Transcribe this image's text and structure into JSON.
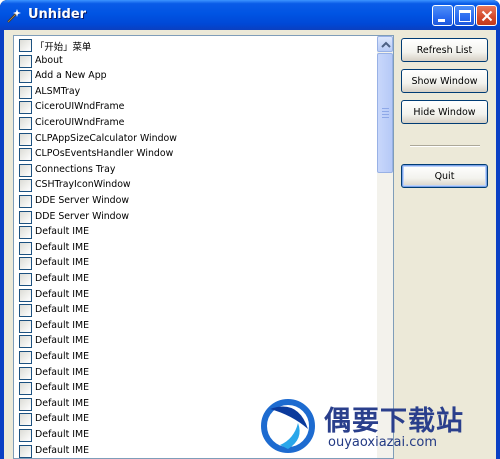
{
  "window": {
    "title": "Unhider",
    "controls": [
      "minimize-icon",
      "maximize-icon",
      "close-icon"
    ]
  },
  "list": {
    "items": [
      "「开始」菜单",
      "About",
      "Add a New App",
      "ALSMTray",
      "CiceroUIWndFrame",
      "CiceroUIWndFrame",
      "CLPAppSizeCalculator Window",
      "CLPOsEventsHandler Window",
      "Connections Tray",
      "CSHTrayIconWindow",
      "DDE Server Window",
      "DDE Server Window",
      "Default IME",
      "Default IME",
      "Default IME",
      "Default IME",
      "Default IME",
      "Default IME",
      "Default IME",
      "Default IME",
      "Default IME",
      "Default IME",
      "Default IME",
      "Default IME",
      "Default IME",
      "Default IME",
      "Default IME"
    ]
  },
  "buttons": {
    "refresh": "Refresh List",
    "show": "Show Window",
    "hide": "Hide Window",
    "quit": "Quit"
  },
  "watermark": {
    "title": "偶要下载站",
    "url": "ouyaoxiazai.com"
  },
  "colors": {
    "titlebar": "#0054e3",
    "client_bg": "#ece9d8",
    "list_border": "#7f9db9",
    "button_border": "#003c74"
  }
}
